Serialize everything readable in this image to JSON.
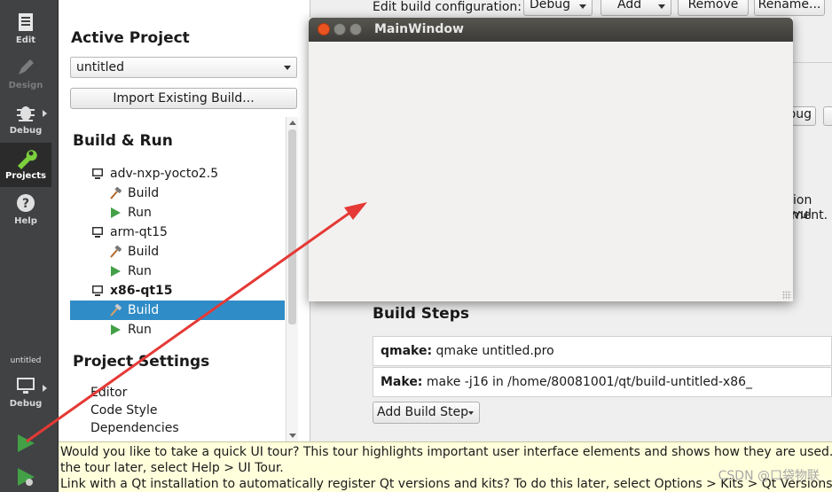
{
  "modebar": {
    "modes": [
      {
        "label": "Edit",
        "icon": "edit-icon"
      },
      {
        "label": "Design",
        "icon": "design-icon"
      },
      {
        "label": "Debug",
        "icon": "debug-icon"
      },
      {
        "label": "Projects",
        "icon": "projects-wrench-icon"
      },
      {
        "label": "Help",
        "icon": "help-icon"
      }
    ],
    "kit_project": "untitled",
    "kit_mode": "Debug"
  },
  "panel": {
    "active_project_title": "Active Project",
    "project_combo_value": "untitled",
    "import_button": "Import Existing Build...",
    "build_run_title": "Build & Run",
    "kits": [
      {
        "name": "adv-nxp-yocto2.5",
        "build": "Build",
        "run": "Run"
      },
      {
        "name": "arm-qt15",
        "build": "Build",
        "run": "Run"
      },
      {
        "name": "x86-qt15",
        "build": "Build",
        "run": "Run"
      }
    ],
    "project_settings_title": "Project Settings",
    "settings": [
      "Editor",
      "Code Style",
      "Dependencies"
    ]
  },
  "main": {
    "edit_config_label": "Edit build configuration:",
    "config_value": "Debug",
    "add_button": "Add",
    "remove_button": "Remove",
    "rename_button": "Rename...",
    "partial_button": "bug",
    "partial_text_1": "ion vul",
    "partial_text_2": "ment.",
    "build_steps_title": "Build Steps",
    "steps": [
      {
        "label": "qmake:",
        "value": "qmake untitled.pro"
      },
      {
        "label": "Make:",
        "value": "make -j16 in /home/80081001/qt/build-untitled-x86_"
      }
    ],
    "add_build_step_button": "Add Build Step"
  },
  "mainwindow": {
    "title": "MainWindow"
  },
  "tourbar": {
    "line1": "Would you like to take a quick UI tour? This tour highlights important user interface elements and shows how they are used. To ta",
    "line2": "the tour later, select Help > UI Tour.",
    "line3": "Link with a Qt installation to automatically register Qt versions and kits? To do this later, select Options > Kits > Qt Versions > Link"
  },
  "watermark": "CSDN @口袋物联",
  "colors": {
    "selection": "#308cc6",
    "arrow": "#e53935",
    "run_green": "#43a047"
  }
}
